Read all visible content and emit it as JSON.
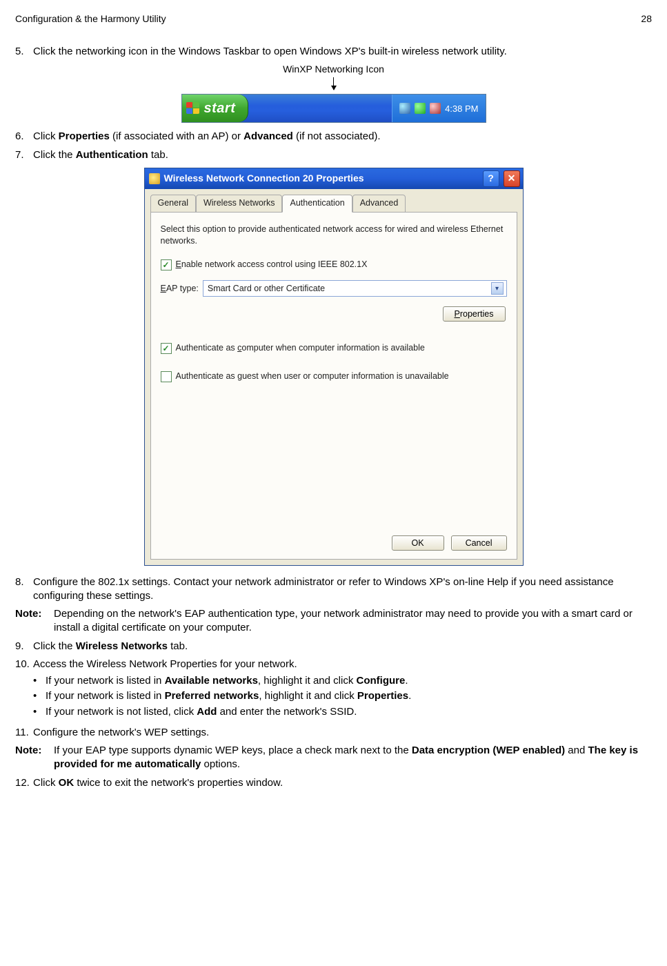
{
  "header": {
    "title": "Configuration & the Harmony Utility",
    "page": "28"
  },
  "steps": {
    "s5": {
      "num": "5.",
      "text": "Click the networking icon in the Windows Taskbar to open Windows XP's built-in wireless network utility."
    },
    "fig1": {
      "label": "WinXP Networking Icon",
      "start": "start",
      "time": "4:38 PM"
    },
    "s6": {
      "num": "6.",
      "pre": "Click ",
      "b1": "Properties",
      "mid": " (if associated with an AP) or ",
      "b2": "Advanced",
      "post": " (if not associated)."
    },
    "s7": {
      "num": "7.",
      "pre": "Click the ",
      "b": "Authentication",
      "post": " tab."
    },
    "dialog": {
      "title": "Wireless Network Connection 20 Properties",
      "tabs": {
        "general": "General",
        "wireless": "Wireless Networks",
        "auth": "Authentication",
        "adv": "Advanced"
      },
      "intro": "Select this option to provide authenticated network access for wired and wireless Ethernet networks.",
      "chk1_pre": "E",
      "chk1_rest": "nable network access control using IEEE 802.1X",
      "eap_label_pre": "E",
      "eap_label_rest": "AP type:",
      "eap_value": "Smart Card or other Certificate",
      "props_btn_pre": "P",
      "props_btn_rest": "roperties",
      "chk2_pre": "Authenticate as ",
      "chk2_u": "c",
      "chk2_rest": "omputer when computer information is available",
      "chk3_pre": "Authenticate as ",
      "chk3_u": "g",
      "chk3_rest": "uest when user or computer information is unavailable",
      "ok": "OK",
      "cancel": "Cancel"
    },
    "s8": {
      "num": "8.",
      "text": "Configure the 802.1x settings. Contact your network administrator or refer to Windows XP's on-line Help if you need assistance configuring these settings."
    },
    "note1": {
      "label": "Note:",
      "text": "Depending on the network's EAP authentication type, your network administrator may need to provide you with a smart card or install a digital certificate on your computer."
    },
    "s9": {
      "num": "9.",
      "pre": "Click the ",
      "b": "Wireless Networks",
      "post": " tab."
    },
    "s10": {
      "num": "10.",
      "text": "Access the Wireless Network Properties for your network.",
      "b1": {
        "pre": "If your network is listed in ",
        "bold1": "Available networks",
        "mid": ", highlight it and click ",
        "bold2": "Configure",
        "post": "."
      },
      "b2": {
        "pre": "If your network is listed in ",
        "bold1": "Preferred networks",
        "mid": ", highlight it and click ",
        "bold2": "Properties",
        "post": "."
      },
      "b3": {
        "pre": "If your network is not listed, click ",
        "bold1": "Add",
        "post": " and enter the network's SSID."
      }
    },
    "s11": {
      "num": "11.",
      "text": "Configure the network's WEP settings."
    },
    "note2": {
      "label": "Note:",
      "pre": "If your EAP type supports dynamic WEP keys, place a check mark next to the ",
      "b1": "Data encryption (WEP enabled)",
      "mid": " and ",
      "b2": "The key is provided for me automatically",
      "post": " options."
    },
    "s12": {
      "num": "12.",
      "pre": "Click ",
      "b": "OK",
      "post": " twice to exit the network's properties window."
    }
  }
}
